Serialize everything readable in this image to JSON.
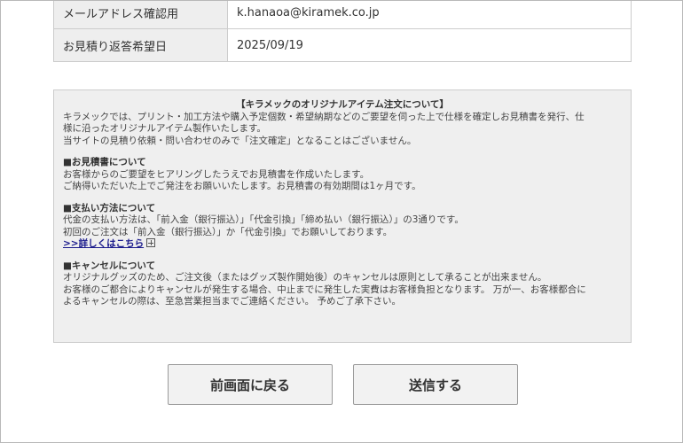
{
  "table": {
    "rows": [
      {
        "label": "メールアドレス確認用",
        "value": "k.hanaoa@kiramek.co.jp"
      },
      {
        "label": "お見積り返答希望日",
        "value": "2025/09/19"
      }
    ]
  },
  "notice": {
    "title": "【キラメックのオリジナルアイテム注文について】",
    "intro": [
      "キラメックでは、プリント・加工方法や購入予定個数・希望納期などのご要望を伺った上で仕様を確定しお見積書を発行、仕",
      "様に沿ったオリジナルアイテム製作いたします。",
      "当サイトの見積り依頼・問い合わせのみで「注文確定」となることはございません。"
    ],
    "estimate": {
      "heading": "■お見積書について",
      "lines": [
        "お客様からのご要望をヒアリングしたうえでお見積書を作成いたします。",
        "ご納得いただいた上でご発注をお願いいたします。お見積書の有効期間は1ヶ月です。"
      ]
    },
    "payment": {
      "heading": "■支払い方法について",
      "lines": [
        "代金の支払い方法は、「前入金（銀行振込）」「代金引換」「締め払い（銀行振込）」の3通りです。",
        "初回のご注文は「前入金（銀行振込）」か「代金引換」でお願いしております。"
      ],
      "link": ">>詳しくはこちら"
    },
    "cancel": {
      "heading": "■キャンセルについて",
      "lines": [
        "オリジナルグッズのため、ご注文後（またはグッズ製作開始後）のキャンセルは原則として承ることが出来ません。",
        "お客様のご都合によりキャンセルが発生する場合、中止までに発生した実費はお客様負担となります。 万が一、お客様都合に",
        "よるキャンセルの際は、至急営業担当までご連絡ください。 予めご了承下さい。"
      ]
    }
  },
  "buttons": {
    "back_label": "前画面に戻る",
    "send_label": "送信する"
  },
  "icons": {
    "expand": "plus-square-icon"
  }
}
